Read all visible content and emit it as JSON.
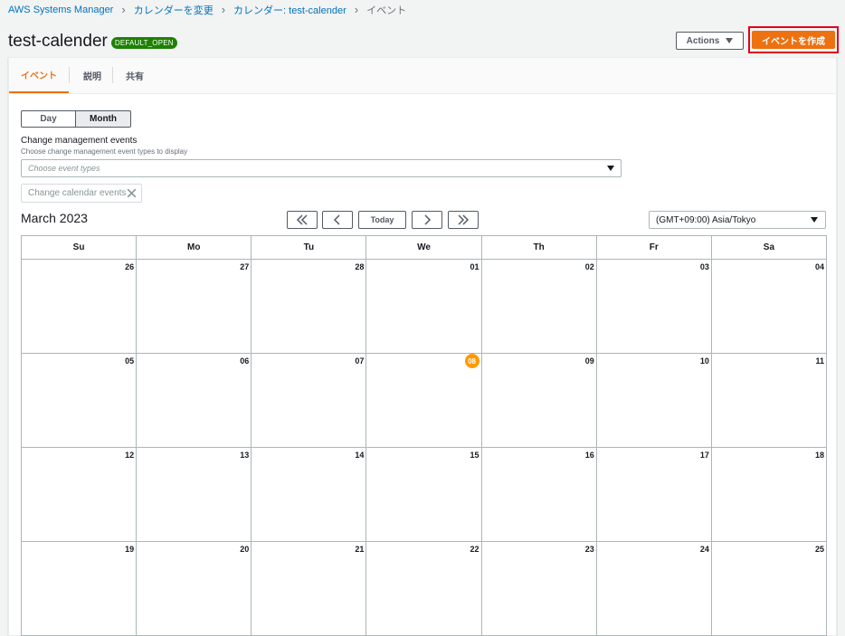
{
  "breadcrumb": {
    "items": [
      "AWS Systems Manager",
      "カレンダーを変更",
      "カレンダー: test-calender"
    ],
    "current": "イベント"
  },
  "header": {
    "title": "test-calender",
    "status": "DEFAULT_OPEN",
    "actions_label": "Actions",
    "create_label": "イベントを作成"
  },
  "tabs": [
    "イベント",
    "説明",
    "共有"
  ],
  "view_toggle": {
    "day": "Day",
    "month": "Month",
    "selected": "Month"
  },
  "filter": {
    "label": "Change management events",
    "description": "Choose change management event types to display",
    "placeholder": "Choose event types",
    "token": "Change calendar events"
  },
  "calendar": {
    "month_title": "March 2023",
    "today_label": "Today",
    "timezone": "(GMT+09:00) Asia/Tokyo",
    "weekdays": [
      "Su",
      "Mo",
      "Tu",
      "We",
      "Th",
      "Fr",
      "Sa"
    ],
    "weeks": [
      [
        "26",
        "27",
        "28",
        "01",
        "02",
        "03",
        "04"
      ],
      [
        "05",
        "06",
        "07",
        "08",
        "09",
        "10",
        "11"
      ],
      [
        "12",
        "13",
        "14",
        "15",
        "16",
        "17",
        "18"
      ],
      [
        "19",
        "20",
        "21",
        "22",
        "23",
        "24",
        "25"
      ]
    ],
    "today": "08"
  },
  "colors": {
    "accent": "#ec7211",
    "status_green": "#1d8102",
    "highlight_border": "#e3001b",
    "today_badge": "#ff9900",
    "link": "#0073bb"
  }
}
